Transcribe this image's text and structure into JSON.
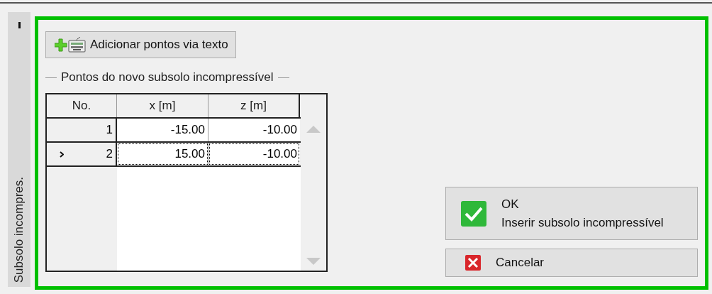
{
  "side_tab": {
    "label": "Subsolo incompres."
  },
  "add_button": {
    "label": "Adicionar pontos via texto"
  },
  "group": {
    "title": "Pontos do novo subsolo incompressível"
  },
  "table": {
    "columns": [
      "No.",
      "x [m]",
      "z [m]"
    ],
    "rows": [
      {
        "cells": [
          "1",
          "-15.00",
          "-10.00"
        ],
        "selected": false
      },
      {
        "cells": [
          "2",
          "15.00",
          "-10.00"
        ],
        "selected": true
      }
    ]
  },
  "ok_button": {
    "title": "OK",
    "label": "Inserir subsolo incompressível"
  },
  "cancel_button": {
    "label": "Cancelar"
  }
}
